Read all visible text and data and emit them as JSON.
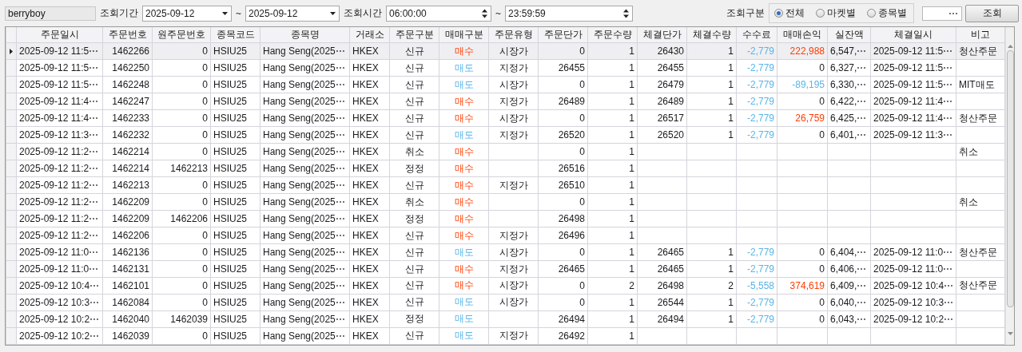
{
  "toolbar": {
    "account": "berryboy",
    "period_label": "조회기간",
    "date_from": "2025-09-12",
    "date_sep_1": "~",
    "date_to": "2025-09-12",
    "time_label": "조회시간",
    "time_from": "06:00:00",
    "time_sep": "~",
    "time_to": "23:59:59",
    "view_label": "조회구분",
    "view_options": [
      {
        "label": "전체",
        "selected": true
      },
      {
        "label": "마켓별",
        "selected": false
      },
      {
        "label": "종목별",
        "selected": false
      }
    ],
    "browse_button": "⋯",
    "search_button": "조회"
  },
  "table": {
    "columns": [
      "주문일시",
      "주문번호",
      "원주문번호",
      "종목코드",
      "종목명",
      "거래소",
      "주문구분",
      "매매구분",
      "주문유형",
      "주문단가",
      "주문수량",
      "체결단가",
      "체결수량",
      "수수료",
      "매매손익",
      "실잔액",
      "체결일시",
      "비고"
    ],
    "rows": [
      {
        "selected": true,
        "ordered_at": "2025-09-12 11:5⋯",
        "order_no": "1462266",
        "orig_order_no": "0",
        "code": "HSIU25",
        "name": "Hang Seng(2025⋯",
        "exchange": "HKEX",
        "order_kind": "신규",
        "side": {
          "text": "매수",
          "kind": "buy"
        },
        "order_type": "시장가",
        "order_price": "0",
        "order_qty": "1",
        "fill_price": "26430",
        "fill_qty": "1",
        "fee": "-2,779",
        "pnl": {
          "text": "222,988",
          "kind": "gain"
        },
        "balance": "6,547,⋯",
        "filled_at": "2025-09-12 11:5⋯",
        "note": "청산주문"
      },
      {
        "selected": false,
        "ordered_at": "2025-09-12 11:5⋯",
        "order_no": "1462250",
        "orig_order_no": "0",
        "code": "HSIU25",
        "name": "Hang Seng(2025⋯",
        "exchange": "HKEX",
        "order_kind": "신규",
        "side": {
          "text": "매도",
          "kind": "sell"
        },
        "order_type": "지정가",
        "order_price": "26455",
        "order_qty": "1",
        "fill_price": "26455",
        "fill_qty": "1",
        "fee": "-2,779",
        "pnl": {
          "text": "0",
          "kind": "flat"
        },
        "balance": "6,327,⋯",
        "filled_at": "2025-09-12 11:5⋯"
      },
      {
        "selected": false,
        "ordered_at": "2025-09-12 11:5⋯",
        "order_no": "1462248",
        "orig_order_no": "0",
        "code": "HSIU25",
        "name": "Hang Seng(2025⋯",
        "exchange": "HKEX",
        "order_kind": "신규",
        "side": {
          "text": "매도",
          "kind": "sell"
        },
        "order_type": "시장가",
        "order_price": "0",
        "order_qty": "1",
        "fill_price": "26479",
        "fill_qty": "1",
        "fee": "-2,779",
        "pnl": {
          "text": "-89,195",
          "kind": "loss"
        },
        "balance": "6,330,⋯",
        "filled_at": "2025-09-12 11:5⋯",
        "note": "MIT매도"
      },
      {
        "selected": false,
        "ordered_at": "2025-09-12 11:4⋯",
        "order_no": "1462247",
        "orig_order_no": "0",
        "code": "HSIU25",
        "name": "Hang Seng(2025⋯",
        "exchange": "HKEX",
        "order_kind": "신규",
        "side": {
          "text": "매수",
          "kind": "buy"
        },
        "order_type": "지정가",
        "order_price": "26489",
        "order_qty": "1",
        "fill_price": "26489",
        "fill_qty": "1",
        "fee": "-2,779",
        "pnl": {
          "text": "0",
          "kind": "flat"
        },
        "balance": "6,422,⋯",
        "filled_at": "2025-09-12 11:4⋯"
      },
      {
        "selected": false,
        "ordered_at": "2025-09-12 11:4⋯",
        "order_no": "1462233",
        "orig_order_no": "0",
        "code": "HSIU25",
        "name": "Hang Seng(2025⋯",
        "exchange": "HKEX",
        "order_kind": "신규",
        "side": {
          "text": "매수",
          "kind": "buy"
        },
        "order_type": "시장가",
        "order_price": "0",
        "order_qty": "1",
        "fill_price": "26517",
        "fill_qty": "1",
        "fee": "-2,779",
        "pnl": {
          "text": "26,759",
          "kind": "gain"
        },
        "balance": "6,425,⋯",
        "filled_at": "2025-09-12 11:4⋯",
        "note": "청산주문"
      },
      {
        "selected": false,
        "ordered_at": "2025-09-12 11:3⋯",
        "order_no": "1462232",
        "orig_order_no": "0",
        "code": "HSIU25",
        "name": "Hang Seng(2025⋯",
        "exchange": "HKEX",
        "order_kind": "신규",
        "side": {
          "text": "매도",
          "kind": "sell"
        },
        "order_type": "지정가",
        "order_price": "26520",
        "order_qty": "1",
        "fill_price": "26520",
        "fill_qty": "1",
        "fee": "-2,779",
        "pnl": {
          "text": "0",
          "kind": "flat"
        },
        "balance": "6,401,⋯",
        "filled_at": "2025-09-12 11:3⋯"
      },
      {
        "selected": false,
        "ordered_at": "2025-09-12 11:2⋯",
        "order_no": "1462214",
        "orig_order_no": "0",
        "code": "HSIU25",
        "name": "Hang Seng(2025⋯",
        "exchange": "HKEX",
        "order_kind": "취소",
        "side": {
          "text": "매수",
          "kind": "buy"
        },
        "order_price": "0",
        "order_qty": "1",
        "note": "취소"
      },
      {
        "selected": false,
        "ordered_at": "2025-09-12 11:2⋯",
        "order_no": "1462214",
        "orig_order_no": "1462213",
        "code": "HSIU25",
        "name": "Hang Seng(2025⋯",
        "exchange": "HKEX",
        "order_kind": "정정",
        "side": {
          "text": "매수",
          "kind": "buy"
        },
        "order_price": "26516",
        "order_qty": "1"
      },
      {
        "selected": false,
        "ordered_at": "2025-09-12 11:2⋯",
        "order_no": "1462213",
        "orig_order_no": "0",
        "code": "HSIU25",
        "name": "Hang Seng(2025⋯",
        "exchange": "HKEX",
        "order_kind": "신규",
        "side": {
          "text": "매수",
          "kind": "buy"
        },
        "order_type": "지정가",
        "order_price": "26510",
        "order_qty": "1"
      },
      {
        "selected": false,
        "ordered_at": "2025-09-12 11:2⋯",
        "order_no": "1462209",
        "orig_order_no": "0",
        "code": "HSIU25",
        "name": "Hang Seng(2025⋯",
        "exchange": "HKEX",
        "order_kind": "취소",
        "side": {
          "text": "매수",
          "kind": "buy"
        },
        "order_price": "0",
        "order_qty": "1",
        "note": "취소"
      },
      {
        "selected": false,
        "ordered_at": "2025-09-12 11:2⋯",
        "order_no": "1462209",
        "orig_order_no": "1462206",
        "code": "HSIU25",
        "name": "Hang Seng(2025⋯",
        "exchange": "HKEX",
        "order_kind": "정정",
        "side": {
          "text": "매수",
          "kind": "buy"
        },
        "order_price": "26498",
        "order_qty": "1"
      },
      {
        "selected": false,
        "ordered_at": "2025-09-12 11:2⋯",
        "order_no": "1462206",
        "orig_order_no": "0",
        "code": "HSIU25",
        "name": "Hang Seng(2025⋯",
        "exchange": "HKEX",
        "order_kind": "신규",
        "side": {
          "text": "매수",
          "kind": "buy"
        },
        "order_type": "지정가",
        "order_price": "26496",
        "order_qty": "1"
      },
      {
        "selected": false,
        "ordered_at": "2025-09-12 11:0⋯",
        "order_no": "1462136",
        "orig_order_no": "0",
        "code": "HSIU25",
        "name": "Hang Seng(2025⋯",
        "exchange": "HKEX",
        "order_kind": "신규",
        "side": {
          "text": "매도",
          "kind": "sell"
        },
        "order_type": "시장가",
        "order_price": "0",
        "order_qty": "1",
        "fill_price": "26465",
        "fill_qty": "1",
        "fee": "-2,779",
        "pnl": {
          "text": "0",
          "kind": "flat"
        },
        "balance": "6,404,⋯",
        "filled_at": "2025-09-12 11:0⋯",
        "note": "청산주문"
      },
      {
        "selected": false,
        "ordered_at": "2025-09-12 11:0⋯",
        "order_no": "1462131",
        "orig_order_no": "0",
        "code": "HSIU25",
        "name": "Hang Seng(2025⋯",
        "exchange": "HKEX",
        "order_kind": "신규",
        "side": {
          "text": "매수",
          "kind": "buy"
        },
        "order_type": "지정가",
        "order_price": "26465",
        "order_qty": "1",
        "fill_price": "26465",
        "fill_qty": "1",
        "fee": "-2,779",
        "pnl": {
          "text": "0",
          "kind": "flat"
        },
        "balance": "6,406,⋯",
        "filled_at": "2025-09-12 11:0⋯"
      },
      {
        "selected": false,
        "ordered_at": "2025-09-12 10:4⋯",
        "order_no": "1462101",
        "orig_order_no": "0",
        "code": "HSIU25",
        "name": "Hang Seng(2025⋯",
        "exchange": "HKEX",
        "order_kind": "신규",
        "side": {
          "text": "매수",
          "kind": "buy"
        },
        "order_type": "시장가",
        "order_price": "0",
        "order_qty": "2",
        "fill_price": "26498",
        "fill_qty": "2",
        "fee": "-5,558",
        "pnl": {
          "text": "374,619",
          "kind": "gain"
        },
        "balance": "6,409,⋯",
        "filled_at": "2025-09-12 10:4⋯",
        "note": "청산주문"
      },
      {
        "selected": false,
        "ordered_at": "2025-09-12 10:3⋯",
        "order_no": "1462084",
        "orig_order_no": "0",
        "code": "HSIU25",
        "name": "Hang Seng(2025⋯",
        "exchange": "HKEX",
        "order_kind": "신규",
        "side": {
          "text": "매도",
          "kind": "sell"
        },
        "order_type": "시장가",
        "order_price": "0",
        "order_qty": "1",
        "fill_price": "26544",
        "fill_qty": "1",
        "fee": "-2,779",
        "pnl": {
          "text": "0",
          "kind": "flat"
        },
        "balance": "6,040,⋯",
        "filled_at": "2025-09-12 10:3⋯"
      },
      {
        "selected": false,
        "ordered_at": "2025-09-12 10:2⋯",
        "order_no": "1462040",
        "orig_order_no": "1462039",
        "code": "HSIU25",
        "name": "Hang Seng(2025⋯",
        "exchange": "HKEX",
        "order_kind": "정정",
        "side": {
          "text": "매도",
          "kind": "sell"
        },
        "order_price": "26494",
        "order_qty": "1",
        "fill_price": "26494",
        "fill_qty": "1",
        "fee": "-2,779",
        "pnl": {
          "text": "0",
          "kind": "flat"
        },
        "balance": "6,043,⋯",
        "filled_at": "2025-09-12 10:2⋯"
      },
      {
        "selected": false,
        "ordered_at": "2025-09-12 10:2⋯",
        "order_no": "1462039",
        "orig_order_no": "0",
        "code": "HSIU25",
        "name": "Hang Seng(2025⋯",
        "exchange": "HKEX",
        "order_kind": "신규",
        "side": {
          "text": "매도",
          "kind": "sell"
        },
        "order_type": "지정가",
        "order_price": "26492",
        "order_qty": "1"
      }
    ]
  }
}
